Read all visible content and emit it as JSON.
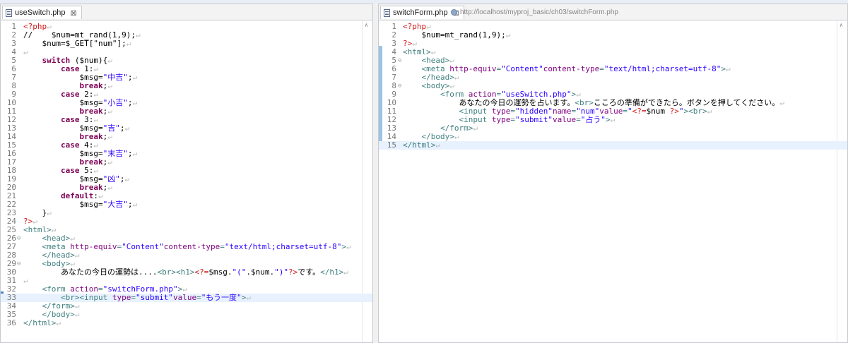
{
  "left_tab": {
    "title": "useSwitch.php",
    "close": "⊠"
  },
  "right_tab": {
    "title": "switchForm.php",
    "close": "⊠",
    "url": "http://localhost/myproj_basic/ch03/switchForm.php"
  },
  "eol": "↵",
  "scroll_up": "∧",
  "left_code": [
    {
      "n": "1",
      "segs": [
        [
          "php",
          "<?php"
        ]
      ]
    },
    {
      "n": "2",
      "segs": [
        [
          "",
          "//  "
        ],
        [
          "ws",
          "  "
        ],
        [
          "",
          "$num=mt_rand(1,9);"
        ]
      ]
    },
    {
      "n": "3",
      "segs": [
        [
          "ws",
          "    "
        ],
        [
          "",
          "$num=$_GET[\"num\"];"
        ]
      ]
    },
    {
      "n": "4",
      "segs": []
    },
    {
      "n": "5",
      "segs": [
        [
          "ws",
          "    "
        ],
        [
          "kw",
          "switch"
        ],
        [
          "",
          " ($num){"
        ]
      ]
    },
    {
      "n": "6",
      "segs": [
        [
          "ws",
          "        "
        ],
        [
          "kw",
          "case"
        ],
        [
          "",
          " 1:"
        ]
      ]
    },
    {
      "n": "7",
      "segs": [
        [
          "ws",
          "            "
        ],
        [
          "",
          "$msg="
        ],
        [
          "str",
          "\"中吉\""
        ],
        [
          "",
          ";"
        ]
      ]
    },
    {
      "n": "8",
      "segs": [
        [
          "ws",
          "            "
        ],
        [
          "kw",
          "break"
        ],
        [
          "",
          ";"
        ]
      ]
    },
    {
      "n": "9",
      "segs": [
        [
          "ws",
          "        "
        ],
        [
          "kw",
          "case"
        ],
        [
          "",
          " 2:"
        ]
      ]
    },
    {
      "n": "10",
      "segs": [
        [
          "ws",
          "            "
        ],
        [
          "",
          "$msg="
        ],
        [
          "str",
          "\"小吉\""
        ],
        [
          "",
          ";"
        ]
      ]
    },
    {
      "n": "11",
      "segs": [
        [
          "ws",
          "            "
        ],
        [
          "kw",
          "break"
        ],
        [
          "",
          ";"
        ]
      ]
    },
    {
      "n": "12",
      "segs": [
        [
          "ws",
          "        "
        ],
        [
          "kw",
          "case"
        ],
        [
          "",
          " 3:"
        ]
      ]
    },
    {
      "n": "13",
      "segs": [
        [
          "ws",
          "            "
        ],
        [
          "",
          "$msg="
        ],
        [
          "str",
          "\"吉\""
        ],
        [
          "",
          ";"
        ]
      ]
    },
    {
      "n": "14",
      "segs": [
        [
          "ws",
          "            "
        ],
        [
          "kw",
          "break"
        ],
        [
          "",
          ";"
        ]
      ]
    },
    {
      "n": "15",
      "segs": [
        [
          "ws",
          "        "
        ],
        [
          "kw",
          "case"
        ],
        [
          "",
          " 4:"
        ]
      ]
    },
    {
      "n": "16",
      "segs": [
        [
          "ws",
          "            "
        ],
        [
          "",
          "$msg="
        ],
        [
          "str",
          "\"末吉\""
        ],
        [
          "",
          ";"
        ]
      ]
    },
    {
      "n": "17",
      "segs": [
        [
          "ws",
          "            "
        ],
        [
          "kw",
          "break"
        ],
        [
          "",
          ";"
        ]
      ]
    },
    {
      "n": "18",
      "segs": [
        [
          "ws",
          "        "
        ],
        [
          "kw",
          "case"
        ],
        [
          "",
          " 5:"
        ]
      ]
    },
    {
      "n": "19",
      "segs": [
        [
          "ws",
          "            "
        ],
        [
          "",
          "$msg="
        ],
        [
          "str",
          "\"凶\""
        ],
        [
          "",
          ";"
        ]
      ]
    },
    {
      "n": "20",
      "segs": [
        [
          "ws",
          "            "
        ],
        [
          "kw",
          "break"
        ],
        [
          "",
          ";"
        ]
      ]
    },
    {
      "n": "21",
      "segs": [
        [
          "ws",
          "        "
        ],
        [
          "kw",
          "default"
        ],
        [
          "",
          ":"
        ]
      ]
    },
    {
      "n": "22",
      "segs": [
        [
          "ws",
          "            "
        ],
        [
          "",
          "$msg="
        ],
        [
          "str",
          "\"大吉\""
        ],
        [
          "",
          ";"
        ]
      ]
    },
    {
      "n": "23",
      "segs": [
        [
          "ws",
          "    "
        ],
        [
          "",
          "}"
        ]
      ]
    },
    {
      "n": "24",
      "segs": [
        [
          "php",
          "?>"
        ]
      ]
    },
    {
      "n": "25",
      "segs": [
        [
          "tag",
          "<html>"
        ]
      ]
    },
    {
      "n": "26",
      "fold": "⊖",
      "segs": [
        [
          "ws",
          "    "
        ],
        [
          "tag",
          "<head>"
        ]
      ]
    },
    {
      "n": "27",
      "segs": [
        [
          "ws",
          "    "
        ],
        [
          "tag",
          "<meta "
        ],
        [
          "attr",
          "http-equiv"
        ],
        [
          "tag",
          "="
        ],
        [
          "str",
          "\"Content\""
        ],
        [
          "attr",
          "content-type"
        ],
        [
          "tag",
          "="
        ],
        [
          "str",
          "\"text/html;charset=utf-8\""
        ],
        [
          "tag",
          ">"
        ]
      ]
    },
    {
      "n": "28",
      "segs": [
        [
          "ws",
          "    "
        ],
        [
          "tag",
          "</head>"
        ]
      ]
    },
    {
      "n": "29",
      "fold": "⊖",
      "segs": [
        [
          "ws",
          "    "
        ],
        [
          "tag",
          "<body>"
        ]
      ]
    },
    {
      "n": "30",
      "segs": [
        [
          "ws",
          "        "
        ],
        [
          "",
          "あなたの今日の運勢は...."
        ],
        [
          "tag",
          "<br><h1>"
        ],
        [
          "php",
          "<?="
        ],
        [
          "",
          "$msg."
        ],
        [
          "str",
          "\"(\""
        ],
        [
          "",
          ".$num."
        ],
        [
          "str",
          "\")\""
        ],
        [
          "php",
          "?>"
        ],
        [
          "",
          "です。"
        ],
        [
          "tag",
          "</h1>"
        ]
      ]
    },
    {
      "n": "31",
      "segs": []
    },
    {
      "n": "32",
      "segs": [
        [
          "ws",
          "    "
        ],
        [
          "tag",
          "<form "
        ],
        [
          "attr",
          "action"
        ],
        [
          "tag",
          "="
        ],
        [
          "str",
          "\"switchForm.php\""
        ],
        [
          "tag",
          ">"
        ]
      ]
    },
    {
      "n": "33",
      "cur": true,
      "segs": [
        [
          "ws",
          "        "
        ],
        [
          "tag",
          "<br><input "
        ],
        [
          "attr",
          "type"
        ],
        [
          "tag",
          "="
        ],
        [
          "str",
          "\"submit\""
        ],
        [
          "attr",
          "value"
        ],
        [
          "tag",
          "="
        ],
        [
          "str",
          "\"もう一度\""
        ],
        [
          "tag",
          ">"
        ]
      ]
    },
    {
      "n": "34",
      "segs": [
        [
          "ws",
          "    "
        ],
        [
          "tag",
          "</form>"
        ]
      ]
    },
    {
      "n": "35",
      "segs": [
        [
          "ws",
          "    "
        ],
        [
          "tag",
          "</body>"
        ]
      ]
    },
    {
      "n": "36",
      "segs": [
        [
          "tag",
          "</html>"
        ]
      ]
    }
  ],
  "right_code": [
    {
      "n": "1",
      "segs": [
        [
          "php",
          "<?php"
        ]
      ]
    },
    {
      "n": "2",
      "segs": [
        [
          "ws",
          "    "
        ],
        [
          "",
          "$num=mt_rand(1,9);"
        ]
      ]
    },
    {
      "n": "3",
      "segs": [
        [
          "php",
          "?>"
        ]
      ]
    },
    {
      "n": "4",
      "segs": [
        [
          "tag",
          "<html>"
        ]
      ]
    },
    {
      "n": "5",
      "fold": "⊖",
      "segs": [
        [
          "ws",
          "    "
        ],
        [
          "tag",
          "<head>"
        ]
      ]
    },
    {
      "n": "6",
      "segs": [
        [
          "ws",
          "    "
        ],
        [
          "tag",
          "<meta "
        ],
        [
          "attr",
          "http-equiv"
        ],
        [
          "tag",
          "="
        ],
        [
          "str",
          "\"Content\""
        ],
        [
          "attr",
          "content-type"
        ],
        [
          "tag",
          "="
        ],
        [
          "str",
          "\"text/html;charset=utf-8\""
        ],
        [
          "tag",
          ">"
        ]
      ]
    },
    {
      "n": "7",
      "segs": [
        [
          "ws",
          "    "
        ],
        [
          "tag",
          "</head>"
        ]
      ]
    },
    {
      "n": "8",
      "fold": "⊖",
      "segs": [
        [
          "ws",
          "    "
        ],
        [
          "tag",
          "<body>"
        ]
      ]
    },
    {
      "n": "9",
      "segs": [
        [
          "ws",
          "        "
        ],
        [
          "tag",
          "<form "
        ],
        [
          "attr",
          "action"
        ],
        [
          "tag",
          "="
        ],
        [
          "str",
          "\"useSwitch.php\""
        ],
        [
          "tag",
          ">"
        ]
      ]
    },
    {
      "n": "10",
      "segs": [
        [
          "ws",
          "            "
        ],
        [
          "",
          "あなたの今日の運勢を占います。"
        ],
        [
          "tag",
          "<br>"
        ],
        [
          "",
          "こころの準備ができたら。ボタンを押してください。"
        ]
      ]
    },
    {
      "n": "11",
      "segs": [
        [
          "ws",
          "            "
        ],
        [
          "tag",
          "<input "
        ],
        [
          "attr",
          "type"
        ],
        [
          "tag",
          "="
        ],
        [
          "str",
          "\"hidden\""
        ],
        [
          "attr",
          "name"
        ],
        [
          "tag",
          "="
        ],
        [
          "str",
          "\"num\""
        ],
        [
          "attr",
          "value"
        ],
        [
          "tag",
          "="
        ],
        [
          "str",
          "\""
        ],
        [
          "php",
          "<?="
        ],
        [
          "",
          "$num "
        ],
        [
          "php",
          "?>"
        ],
        [
          "str",
          "\""
        ],
        [
          "tag",
          "><br>"
        ]
      ]
    },
    {
      "n": "12",
      "segs": [
        [
          "ws",
          "            "
        ],
        [
          "tag",
          "<input "
        ],
        [
          "attr",
          "type"
        ],
        [
          "tag",
          "="
        ],
        [
          "str",
          "\"submit\""
        ],
        [
          "attr",
          "value"
        ],
        [
          "tag",
          "="
        ],
        [
          "str",
          "\"占う\""
        ],
        [
          "tag",
          ">"
        ]
      ]
    },
    {
      "n": "13",
      "segs": [
        [
          "ws",
          "        "
        ],
        [
          "tag",
          "</form>"
        ]
      ]
    },
    {
      "n": "14",
      "segs": [
        [
          "ws",
          "    "
        ],
        [
          "tag",
          "</body>"
        ]
      ]
    },
    {
      "n": "15",
      "cur": true,
      "segs": [
        [
          "tag",
          "</html>"
        ]
      ]
    }
  ]
}
